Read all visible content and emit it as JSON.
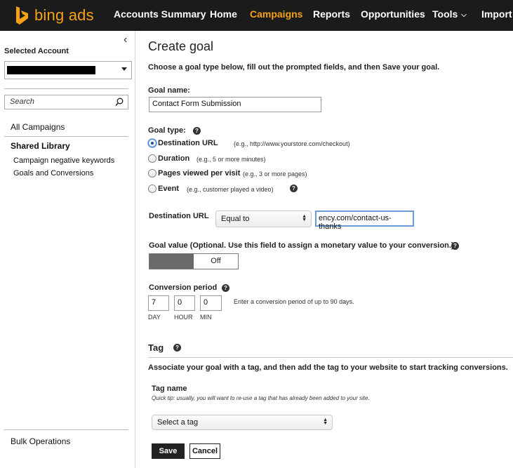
{
  "header": {
    "brand": "bing ads",
    "nav": [
      "Accounts Summary",
      "Home",
      "Campaigns",
      "Reports",
      "Opportunities",
      "Tools",
      "Import C"
    ],
    "active_tab": "Campaigns"
  },
  "sidebar": {
    "collapse_glyph": "‹",
    "selected_account_label": "Selected Account",
    "search_placeholder": "Search",
    "all_campaigns": "All Campaigns",
    "shared_library": "Shared Library",
    "links": [
      "Campaign negative keywords",
      "Goals and Conversions"
    ],
    "bulk_operations": "Bulk Operations"
  },
  "form": {
    "title": "Create goal",
    "instructions": "Choose a goal type below, fill out the prompted fields, and then Save your goal.",
    "goal_name_label": "Goal name:",
    "goal_name_value": "Contact Form Submission",
    "goal_type_label": "Goal type:",
    "goal_types": [
      {
        "label": "Destination URL",
        "hint": "(e.g., http://www.yourstore.com/checkout)",
        "selected": true
      },
      {
        "label": "Duration",
        "hint": "(e.g., 5 or more minutes)",
        "selected": false
      },
      {
        "label": "Pages viewed per visit",
        "hint": "(e.g., 3 or more pages)",
        "selected": false
      },
      {
        "label": "Event",
        "hint": "(e.g., customer played a video)",
        "selected": false
      }
    ],
    "destination_url_label": "Destination URL",
    "match_type": "Equal to",
    "url_value": "ency.com/contact-us-thanks",
    "goal_value_label": "Goal value (Optional. Use this field to assign a monetary value to your conversion.)",
    "goal_value_toggle": "Off",
    "conversion_period_label": "Conversion period",
    "period_values": {
      "day": "7",
      "hour": "0",
      "min": "0"
    },
    "period_units": [
      "DAY",
      "HOUR",
      "MIN"
    ],
    "period_hint": "Enter a conversion period of up to 90 days."
  },
  "tag": {
    "heading": "Tag",
    "description": "Associate your goal with a tag, and then add the tag to your website to start tracking conversions.",
    "tag_name_label": "Tag name",
    "quick_tip": "Quick tip: usually, you will want to re-use a tag that has already been added to your site.",
    "select_placeholder": "Select a tag"
  },
  "actions": {
    "save": "Save",
    "cancel": "Cancel"
  },
  "colors": {
    "topbar": "#1b1b1b",
    "accent": "#f6a116",
    "toggle_dark": "#696969"
  },
  "icons": {
    "help": "question-circle-icon",
    "search": "magnifier-icon",
    "logo": "bing-logo-icon"
  }
}
